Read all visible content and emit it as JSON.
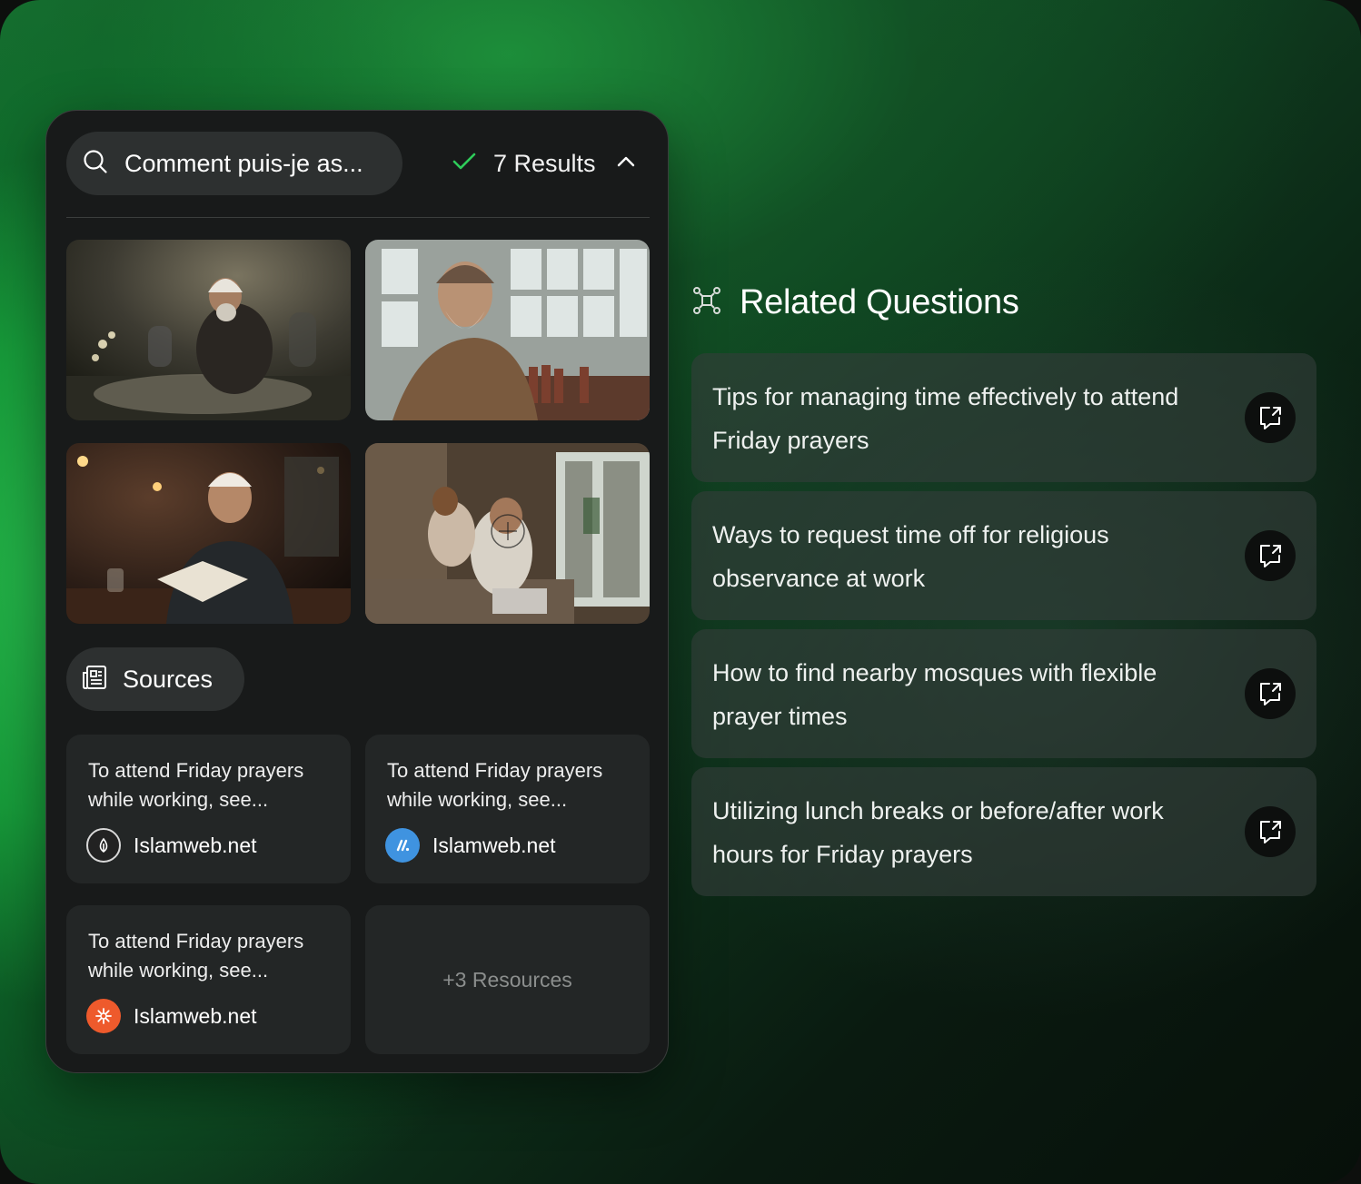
{
  "search": {
    "query": "Comment puis-je as...",
    "results_label": "7 Results",
    "icons": {
      "search": "search-icon",
      "check": "check-icon",
      "toggle": "chevron-up-icon"
    },
    "check_color": "#2ecc5a"
  },
  "images": [
    {
      "alt": "elderly man in white cap praying among graves"
    },
    {
      "alt": "smiling elderly man in cap by library window"
    },
    {
      "alt": "young man in cap reading a book by lamplight"
    },
    {
      "alt": "mother and child with laptop on sofa"
    }
  ],
  "sources": {
    "label": "Sources",
    "icon": "newspaper-icon",
    "items": [
      {
        "snippet": "To attend Friday prayers while working, see...",
        "site": "Islamweb.net",
        "favicon": "leaf-icon",
        "favicon_color": "#222222"
      },
      {
        "snippet": "To attend Friday prayers while working, see...",
        "site": "Islamweb.net",
        "favicon": "signal-icon",
        "favicon_color": "#3f93e0"
      },
      {
        "snippet": "To attend Friday prayers while working, see...",
        "site": "Islamweb.net",
        "favicon": "asterisk-icon",
        "favicon_color": "#ee5a2c"
      }
    ],
    "more_label": "+3 Resources"
  },
  "related": {
    "title": "Related Questions",
    "icon": "focus-icon",
    "items": [
      {
        "text": "Tips for managing time effectively to attend Friday prayers",
        "icon": "open-chat-icon"
      },
      {
        "text": "Ways to request time off for religious observance at work",
        "icon": "open-chat-icon"
      },
      {
        "text": "How to find nearby mosques with flexible prayer times",
        "icon": "open-chat-icon"
      },
      {
        "text": "Utilizing lunch breaks or before/after work hours for Friday prayers",
        "icon": "open-chat-icon"
      }
    ]
  },
  "colors": {
    "accent_green": "#1fa547",
    "panel_bg": "#181a1a"
  }
}
